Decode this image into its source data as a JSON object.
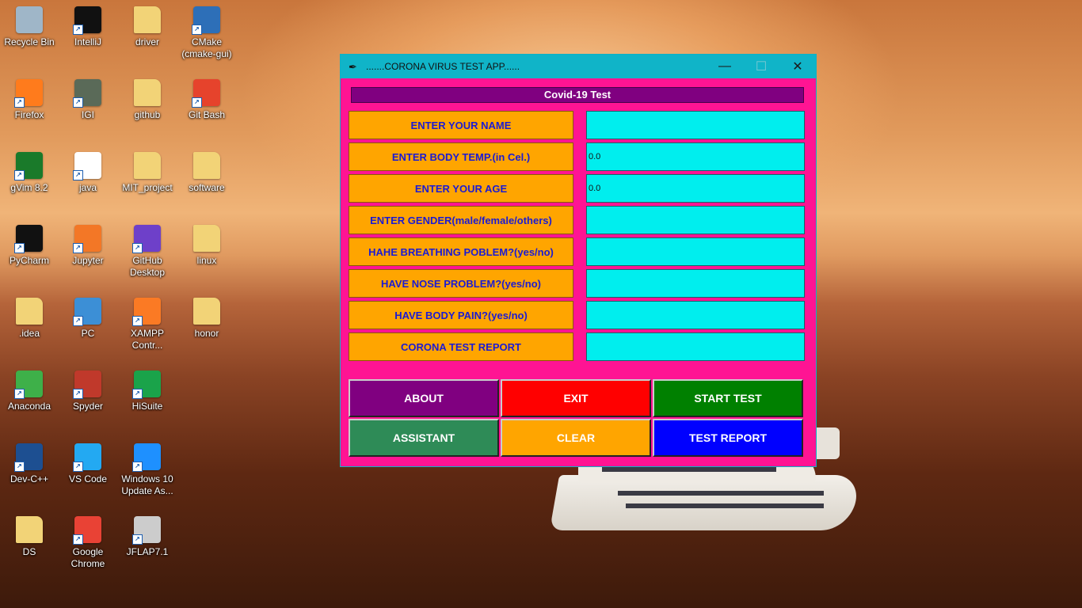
{
  "desktop": {
    "icons": [
      {
        "label": "Recycle Bin",
        "icon": "recycle-bin-icon",
        "color": "#9fb6c8"
      },
      {
        "label": "IntelliJ",
        "icon": "intellij-icon",
        "color": "#111111"
      },
      {
        "label": "driver",
        "icon": "folder-icon",
        "color": "#f2d377"
      },
      {
        "label": "CMake\n(cmake-gui)",
        "icon": "cmake-icon",
        "color": "#2d6fb8"
      },
      {
        "label": "Firefox",
        "icon": "firefox-icon",
        "color": "#ff7b1c"
      },
      {
        "label": "IGI",
        "icon": "igi-icon",
        "color": "#5a6a58"
      },
      {
        "label": "github",
        "icon": "folder-icon",
        "color": "#f2d377"
      },
      {
        "label": "Git Bash",
        "icon": "git-bash-icon",
        "color": "#e6432c"
      },
      {
        "label": "gVim 8.2",
        "icon": "gvim-icon",
        "color": "#1a7a2a"
      },
      {
        "label": "java",
        "icon": "java-icon",
        "color": "#ffffff"
      },
      {
        "label": "MIT_project",
        "icon": "folder-icon",
        "color": "#f2d377"
      },
      {
        "label": "software",
        "icon": "folder-icon",
        "color": "#f2d377"
      },
      {
        "label": "PyCharm",
        "icon": "pycharm-icon",
        "color": "#111111"
      },
      {
        "label": "Jupyter",
        "icon": "jupyter-icon",
        "color": "#f37726"
      },
      {
        "label": "GitHub\nDesktop",
        "icon": "github-desktop-icon",
        "color": "#6e40c9"
      },
      {
        "label": "linux",
        "icon": "folder-icon",
        "color": "#f2d377"
      },
      {
        "label": ".idea",
        "icon": "folder-icon",
        "color": "#f2d377"
      },
      {
        "label": "PC",
        "icon": "pc-icon",
        "color": "#3c8fd6"
      },
      {
        "label": "XAMPP\nContr...",
        "icon": "xampp-icon",
        "color": "#fb7a24"
      },
      {
        "label": "honor",
        "icon": "folder-icon",
        "color": "#f2d377"
      },
      {
        "label": "Anaconda",
        "icon": "anaconda-icon",
        "color": "#3eb049"
      },
      {
        "label": "Spyder",
        "icon": "spyder-icon",
        "color": "#c0392b"
      },
      {
        "label": "HiSuite",
        "icon": "hisuite-icon",
        "color": "#1aa34a"
      },
      {
        "label": "Dev-C++",
        "icon": "devcpp-icon",
        "color": "#1d4f91"
      },
      {
        "label": "VS Code",
        "icon": "vscode-icon",
        "color": "#23a9f2"
      },
      {
        "label": "Windows 10\nUpdate As...",
        "icon": "windows-icon",
        "color": "#1e90ff"
      },
      {
        "label": "DS",
        "icon": "folder-icon",
        "color": "#f2d377"
      },
      {
        "label": "Google\nChrome",
        "icon": "chrome-icon",
        "color": "#e94235"
      },
      {
        "label": "JFLAP7.1",
        "icon": "jflap-icon",
        "color": "#cccccc"
      }
    ]
  },
  "window": {
    "title": ".......CORONA VIRUS TEST APP......",
    "minimize": "—",
    "maximize": "☐",
    "close": "✕",
    "header": "Covid-19 Test",
    "fields": [
      {
        "label": "ENTER YOUR NAME",
        "value": ""
      },
      {
        "label": "ENTER BODY TEMP.(in Cel.)",
        "value": "0.0"
      },
      {
        "label": "ENTER YOUR AGE",
        "value": "0.0"
      },
      {
        "label": "ENTER GENDER(male/female/others)",
        "value": ""
      },
      {
        "label": "HAHE BREATHING POBLEM?(yes/no)",
        "value": ""
      },
      {
        "label": "HAVE NOSE PROBLEM?(yes/no)",
        "value": ""
      },
      {
        "label": "HAVE BODY PAIN?(yes/no)",
        "value": ""
      },
      {
        "label": "CORONA TEST REPORT",
        "value": ""
      }
    ],
    "buttons": [
      {
        "label": "ABOUT",
        "color": "#800080"
      },
      {
        "label": "EXIT",
        "color": "#ff0000"
      },
      {
        "label": "START TEST",
        "color": "#008000"
      },
      {
        "label": "ASSISTANT",
        "color": "#2e8b57"
      },
      {
        "label": "CLEAR",
        "color": "#ffa500"
      },
      {
        "label": "TEST REPORT",
        "color": "#0000ff"
      }
    ]
  }
}
